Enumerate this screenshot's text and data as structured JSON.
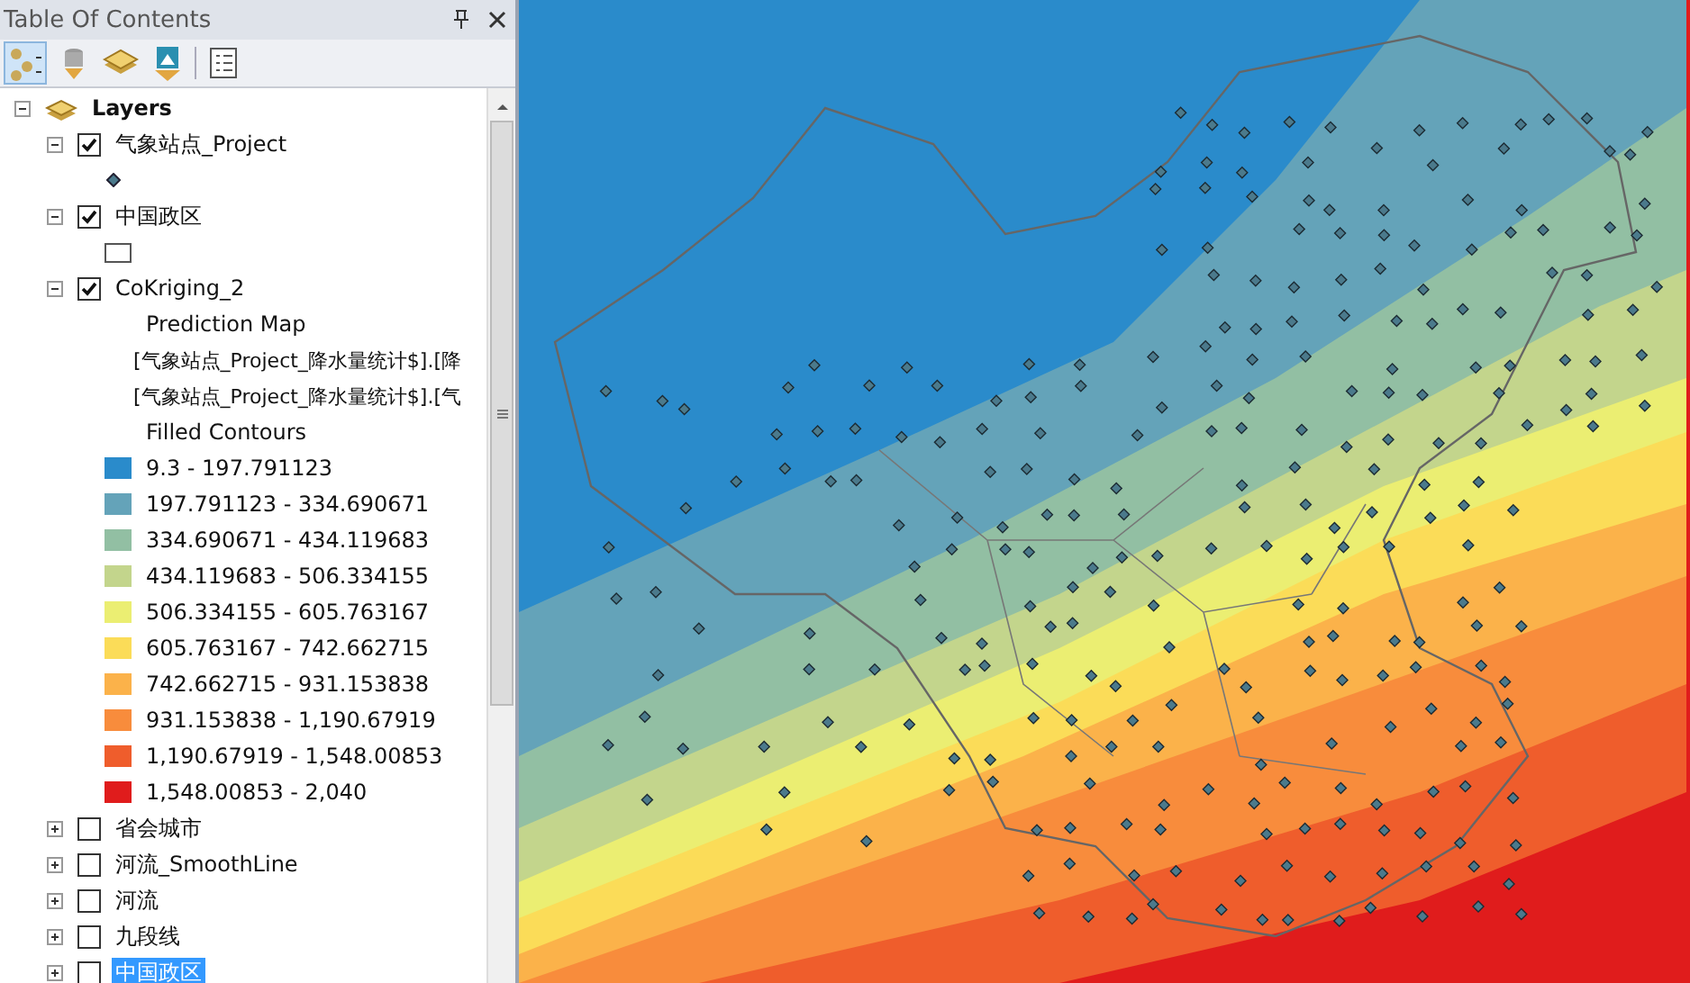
{
  "panel": {
    "title": "Table Of Contents"
  },
  "tree": {
    "label": "Layers",
    "expanded": true,
    "children": [
      {
        "label": "气象站点_Project",
        "expanded": true,
        "checked": true,
        "selected": false,
        "legend": [
          {
            "kind": "point-symbol"
          }
        ]
      },
      {
        "label": "中国政区",
        "expanded": true,
        "checked": true,
        "selected": false,
        "legend": [
          {
            "kind": "polygon-symbol"
          }
        ]
      },
      {
        "label": "CoKriging_2",
        "expanded": true,
        "checked": true,
        "selected": false,
        "legend": [
          {
            "kind": "heading",
            "text": "Prediction Map"
          },
          {
            "kind": "field",
            "text": "[气象站点_Project_降水量统计$].[降"
          },
          {
            "kind": "field",
            "text": "[气象站点_Project_降水量统计$].[气"
          },
          {
            "kind": "heading",
            "text": "Filled Contours"
          },
          {
            "kind": "class",
            "text": "9.3 - 197.791123",
            "color": "#2a8bcb"
          },
          {
            "kind": "class",
            "text": "197.791123 - 334.690671",
            "color": "#64a3b9"
          },
          {
            "kind": "class",
            "text": "334.690671 - 434.119683",
            "color": "#92bfa3"
          },
          {
            "kind": "class",
            "text": "434.119683 - 506.334155",
            "color": "#c3d58c"
          },
          {
            "kind": "class",
            "text": "506.334155 - 605.763167",
            "color": "#ebee72"
          },
          {
            "kind": "class",
            "text": "605.763167 - 742.662715",
            "color": "#fbdc58"
          },
          {
            "kind": "class",
            "text": "742.662715 - 931.153838",
            "color": "#fbb24a"
          },
          {
            "kind": "class",
            "text": "931.153838 - 1,190.67919",
            "color": "#f88c3c"
          },
          {
            "kind": "class",
            "text": "1,190.67919 - 1,548.00853",
            "color": "#ef5d2c"
          },
          {
            "kind": "class",
            "text": "1,548.00853 - 2,040",
            "color": "#e01c1c"
          }
        ]
      },
      {
        "label": "省会城市",
        "expanded": false,
        "checked": false,
        "selected": false
      },
      {
        "label": "河流_SmoothLine",
        "expanded": false,
        "checked": false,
        "selected": false
      },
      {
        "label": "河流",
        "expanded": false,
        "checked": false,
        "selected": false
      },
      {
        "label": "九段线",
        "expanded": false,
        "checked": false,
        "selected": false
      },
      {
        "label": "中国政区",
        "expanded": false,
        "checked": false,
        "selected": true
      }
    ]
  }
}
